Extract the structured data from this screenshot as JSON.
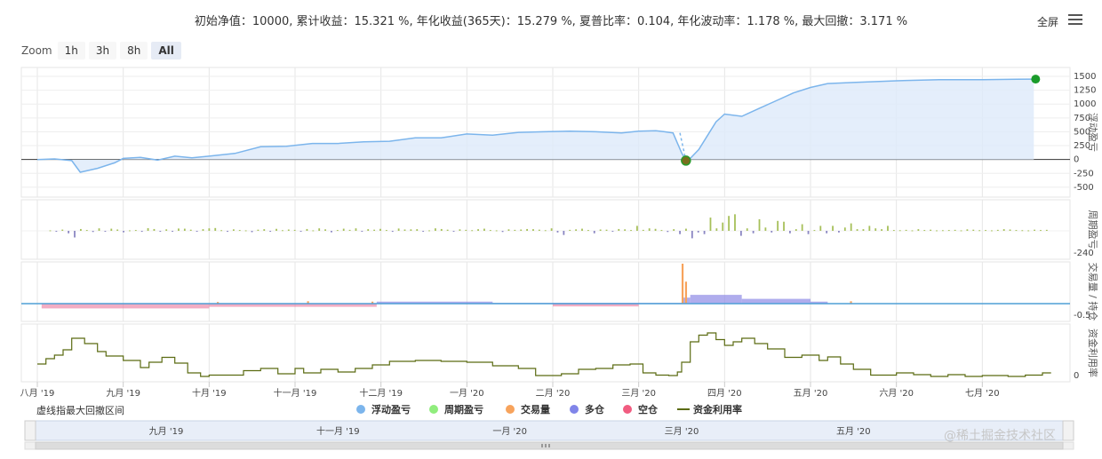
{
  "header": {
    "title": "初始净值：10000, 累计收益：15.321 %, 年化收益(365天)：15.279 %, 夏普比率：0.104, 年化波动率：1.178 %, 最大回撤：3.171 %",
    "fullscreen_label": "全屏"
  },
  "zoom": {
    "label": "Zoom",
    "buttons": [
      "1h",
      "3h",
      "8h",
      "All"
    ],
    "active": "All"
  },
  "footnote": "虚线指最大回撤区间",
  "watermark": "@稀土掘金技术社区",
  "colors": {
    "pnl_line": "#7cb5ec",
    "pnl_fill": "#ddeafa",
    "period_pos": "#a7c05a",
    "period_neg": "#8a86c2",
    "long": "#8f8ae6",
    "short": "#e86a92",
    "volume": "#f7a35c",
    "util_line": "#5b6b12",
    "marker_high": "#1a9b2a",
    "marker_low": "#7a6e1e"
  },
  "chart_data": [
    {
      "type": "area",
      "name": "浮动盈亏",
      "side_title": "浮动盈亏",
      "x_labels": [
        "八月 '19",
        "九月 '19",
        "十月 '19",
        "十一月 '19",
        "十二月 '19",
        "一月 '20",
        "二月 '20",
        "三月 '20",
        "四月 '20",
        "五月 '20",
        "六月 '20",
        "七月 '20"
      ],
      "ylim": [
        -550,
        1500
      ],
      "y_ticks": [
        1500,
        1250,
        1000,
        750,
        500,
        250,
        0,
        -250,
        -500
      ],
      "x": [
        0,
        0.2,
        0.4,
        0.5,
        0.7,
        0.9,
        1.0,
        1.2,
        1.4,
        1.6,
        1.8,
        2.0,
        2.3,
        2.6,
        2.9,
        3.2,
        3.5,
        3.8,
        4.1,
        4.4,
        4.7,
        5.0,
        5.3,
        5.6,
        5.9,
        6.2,
        6.5,
        6.8,
        7.0,
        7.2,
        7.3,
        7.4,
        7.5,
        7.55,
        7.6,
        7.7,
        7.8,
        7.9,
        8.0,
        8.2,
        8.4,
        8.6,
        8.8,
        9.0,
        9.2,
        9.5,
        10.0,
        10.5,
        11.0,
        11.6
      ],
      "values": [
        0,
        10,
        -20,
        -230,
        -160,
        -60,
        20,
        40,
        -10,
        60,
        30,
        60,
        110,
        230,
        240,
        290,
        290,
        320,
        330,
        390,
        390,
        460,
        440,
        490,
        500,
        510,
        500,
        480,
        510,
        520,
        500,
        480,
        120,
        -20,
        20,
        180,
        430,
        680,
        820,
        780,
        920,
        1060,
        1200,
        1300,
        1370,
        1390,
        1420,
        1440,
        1440,
        1450
      ],
      "max_drawdown": {
        "start_x": 7.5,
        "end_x": 7.55,
        "high": 480,
        "low": -20
      }
    },
    {
      "type": "bar",
      "name": "周期盈亏",
      "side_title": "周期盈亏",
      "y_ticks": [
        -240
      ],
      "ylim": [
        -240,
        300
      ],
      "values": [
        6,
        -10,
        15,
        -30,
        -80,
        22,
        10,
        -14,
        30,
        -8,
        26,
        16,
        -18,
        6,
        10,
        -12,
        32,
        22,
        -8,
        18,
        -10,
        28,
        26,
        14,
        -6,
        20,
        30,
        34,
        8,
        -12,
        18,
        10,
        6,
        -16,
        14,
        20,
        -10,
        24,
        8,
        16,
        12,
        -8,
        22,
        6,
        30,
        18,
        -18,
        10,
        26,
        12,
        30,
        -6,
        20,
        14,
        24,
        10,
        -12,
        28,
        16,
        18,
        20,
        -8,
        6,
        30,
        22,
        14,
        -10,
        18,
        12,
        8,
        20,
        26,
        10,
        6,
        -14,
        18,
        12,
        16,
        22,
        20,
        14,
        8,
        30,
        -20,
        -50,
        12,
        18,
        26,
        10,
        -30,
        16,
        14,
        -8,
        22,
        18,
        10,
        60,
        12,
        30,
        24,
        10,
        -14,
        20,
        -40,
        26,
        -90,
        -20,
        -40,
        160,
        30,
        100,
        180,
        200,
        -60,
        30,
        -30,
        140,
        40,
        -20,
        120,
        110,
        -30,
        20,
        80,
        -40,
        10,
        60,
        -30,
        60,
        -20,
        40,
        90,
        20,
        20,
        60,
        30,
        20,
        60,
        10,
        8,
        12,
        6,
        20,
        10,
        14,
        6,
        8,
        10,
        12,
        6,
        18,
        14,
        8,
        10,
        6,
        12,
        20,
        16,
        10,
        8,
        6,
        14,
        10,
        12
      ],
      "x_start": 0.15,
      "x_end": 11.75
    },
    {
      "type": "area",
      "name": "交易量 / 持仓",
      "side_title": "交易量 / 持仓",
      "y_ticks": [
        -0.5
      ],
      "ylim": [
        -0.5,
        1.0
      ],
      "long": {
        "start_x": 3.95,
        "segments": [
          [
            3.95,
            5.3,
            0.05
          ],
          [
            5.3,
            7.5,
            0.02
          ],
          [
            7.5,
            7.6,
            0.15
          ],
          [
            7.6,
            8.2,
            0.22
          ],
          [
            8.2,
            9.0,
            0.12
          ],
          [
            9.0,
            9.2,
            0.05
          ]
        ]
      },
      "short": {
        "segments": [
          [
            0.05,
            2.0,
            -0.12
          ],
          [
            2.0,
            3.95,
            -0.08
          ],
          [
            6.0,
            7.0,
            -0.07
          ]
        ]
      },
      "volume_spikes": [
        [
          7.51,
          1.0
        ],
        [
          7.55,
          0.55
        ],
        [
          3.15,
          0.06
        ],
        [
          2.1,
          0.04
        ],
        [
          9.47,
          0.06
        ],
        [
          3.9,
          0.05
        ]
      ]
    },
    {
      "type": "line",
      "name": "资金利用率",
      "side_title": "资金利用率",
      "y_ticks": [
        0
      ],
      "ylim": [
        0,
        1.0
      ],
      "step_points": [
        [
          0,
          0.3
        ],
        [
          0.1,
          0.42
        ],
        [
          0.2,
          0.5
        ],
        [
          0.3,
          0.62
        ],
        [
          0.4,
          0.88
        ],
        [
          0.55,
          0.76
        ],
        [
          0.7,
          0.58
        ],
        [
          0.8,
          0.48
        ],
        [
          1.0,
          0.38
        ],
        [
          1.2,
          0.22
        ],
        [
          1.3,
          0.34
        ],
        [
          1.45,
          0.45
        ],
        [
          1.6,
          0.32
        ],
        [
          1.75,
          0.1
        ],
        [
          1.9,
          0.02
        ],
        [
          2.0,
          0.05
        ],
        [
          2.2,
          0.05
        ],
        [
          2.4,
          0.15
        ],
        [
          2.6,
          0.2
        ],
        [
          2.8,
          0.08
        ],
        [
          3.0,
          0.2
        ],
        [
          3.1,
          0.1
        ],
        [
          3.3,
          0.18
        ],
        [
          3.5,
          0.12
        ],
        [
          3.7,
          0.2
        ],
        [
          3.9,
          0.28
        ],
        [
          4.1,
          0.36
        ],
        [
          4.4,
          0.38
        ],
        [
          4.7,
          0.36
        ],
        [
          5.0,
          0.34
        ],
        [
          5.3,
          0.26
        ],
        [
          5.6,
          0.2
        ],
        [
          5.8,
          0.04
        ],
        [
          5.95,
          0.04
        ],
        [
          6.1,
          0.08
        ],
        [
          6.3,
          0.18
        ],
        [
          6.5,
          0.2
        ],
        [
          6.7,
          0.28
        ],
        [
          6.9,
          0.3
        ],
        [
          7.05,
          0.1
        ],
        [
          7.2,
          0.05
        ],
        [
          7.35,
          0.04
        ],
        [
          7.45,
          0.12
        ],
        [
          7.5,
          0.34
        ],
        [
          7.6,
          0.8
        ],
        [
          7.7,
          0.95
        ],
        [
          7.8,
          1.0
        ],
        [
          7.9,
          0.85
        ],
        [
          8.0,
          0.72
        ],
        [
          8.1,
          0.8
        ],
        [
          8.2,
          0.88
        ],
        [
          8.35,
          0.76
        ],
        [
          8.5,
          0.64
        ],
        [
          8.7,
          0.45
        ],
        [
          8.9,
          0.5
        ],
        [
          9.1,
          0.38
        ],
        [
          9.2,
          0.46
        ],
        [
          9.35,
          0.3
        ],
        [
          9.5,
          0.18
        ],
        [
          9.7,
          0.05
        ],
        [
          10.0,
          0.1
        ],
        [
          10.2,
          0.06
        ],
        [
          10.4,
          0.02
        ],
        [
          10.6,
          0.06
        ],
        [
          10.8,
          0.02
        ],
        [
          11.0,
          0.04
        ],
        [
          11.3,
          0.02
        ],
        [
          11.5,
          0.05
        ],
        [
          11.7,
          0.1
        ],
        [
          11.8,
          0.1
        ]
      ]
    }
  ],
  "legend": [
    {
      "label": "浮动盈亏",
      "color": "#7cb5ec",
      "shape": "circle"
    },
    {
      "label": "周期盈亏",
      "color": "#90ed7d",
      "shape": "circle"
    },
    {
      "label": "交易量",
      "color": "#f7a35c",
      "shape": "circle"
    },
    {
      "label": "多仓",
      "color": "#8085e9",
      "shape": "circle"
    },
    {
      "label": "空仓",
      "color": "#f15c80",
      "shape": "circle"
    },
    {
      "label": "资金利用率",
      "color": "#5b6b12",
      "shape": "line"
    }
  ],
  "navigator": {
    "labels": [
      "九月 '19",
      "十一月 '19",
      "一月 '20",
      "三月 '20",
      "五月 '20"
    ]
  }
}
